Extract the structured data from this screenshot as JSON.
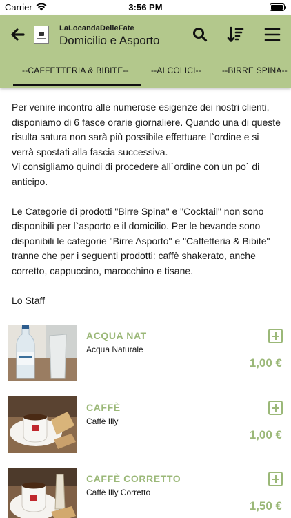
{
  "status_bar": {
    "carrier": "Carrier",
    "time": "3:56 PM"
  },
  "header": {
    "brand": "LaLocandaDelleFate",
    "title": "Domicilio e Asporto",
    "icons": [
      "back-arrow-icon",
      "search-icon",
      "sort-icon",
      "menu-icon"
    ],
    "background": "#b3c88c"
  },
  "tabs": [
    {
      "label": "--CAFFETTERIA & BIBITE--",
      "active": true
    },
    {
      "label": "--ALCOLICI--",
      "active": false
    },
    {
      "label": "--BIRRE SPINA--",
      "active": false
    }
  ],
  "intro": {
    "paragraphs": [
      "Per venire incontro alle numerose esigenze dei nostri clienti, disponiamo di 6 fasce orarie giornaliere. Quando una di queste risulta satura non sarà più possibile effettuare l`ordine e si verrà spostati alla fascia successiva.\nVi consigliamo quindi di procedere all`ordine con un po` di anticipo.",
      "Le Categorie di prodotti \"Birre Spina\" e \"Cocktail\" non sono disponibili per l`asporto e il domicilio. Per le bevande sono disponibili le categorie \"Birre Asporto\" e \"Caffetteria & Bibite\" tranne che per i seguenti prodotti: caffè shakerato, anche corretto, cappuccino, marocchino e tisane.",
      "Lo Staff"
    ]
  },
  "products": [
    {
      "name": "ACQUA NAT",
      "description": "Acqua Naturale",
      "price": "1,00 €"
    },
    {
      "name": "CAFFÈ",
      "description": "Caffè Illy",
      "price": "1,00 €"
    },
    {
      "name": "CAFFÈ CORRETTO",
      "description": "Caffè Illy Corretto",
      "price": "1,50 €"
    }
  ],
  "accent_color": "#9bb878"
}
